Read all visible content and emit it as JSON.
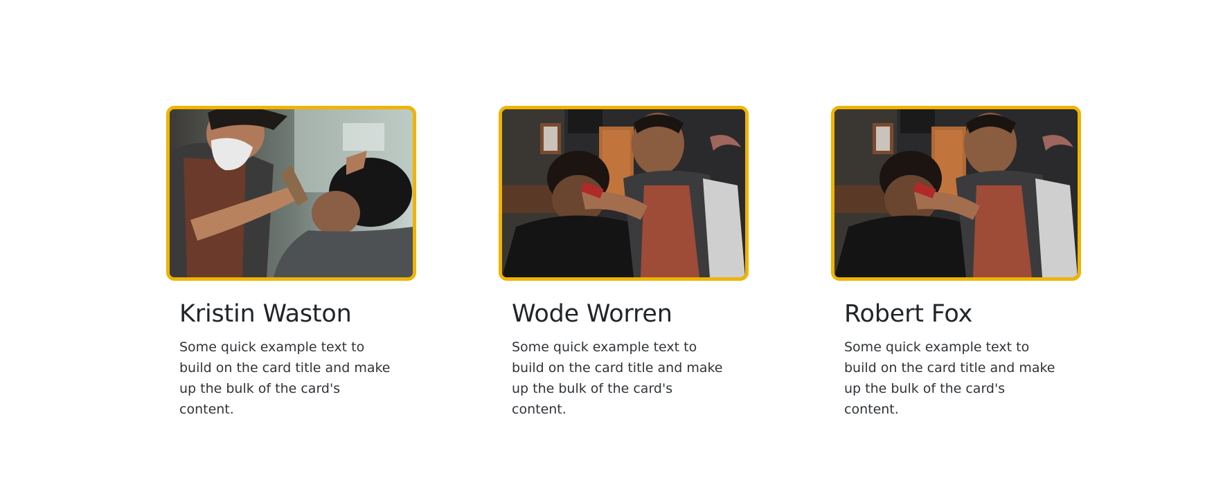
{
  "cards": [
    {
      "image": "barber-shaving-client-photo",
      "title": "Kristin Waston",
      "text": "Some quick example text to build on the card title and make up the bulk of the card's content."
    },
    {
      "image": "barber-trimming-client-photo",
      "title": "Wode Worren",
      "text": "Some quick example text to build on the card title and make up the bulk of the card's content."
    },
    {
      "image": "barber-trimming-client-photo",
      "title": "Robert Fox",
      "text": "Some quick example text to build on the card title and make up the bulk of the card's content."
    }
  ],
  "colors": {
    "card_border": "#f0b400",
    "title": "#212529",
    "text": "#2f3337",
    "background": "#ffffff"
  }
}
